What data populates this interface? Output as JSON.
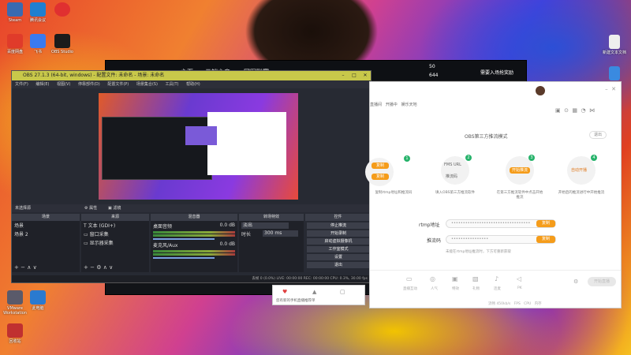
{
  "desktop": {
    "icons_left": [
      {
        "label": "Steam",
        "color": "#3a6ab0"
      },
      {
        "label": "腾讯会议",
        "color": "#1f7fd0"
      },
      {
        "label": "",
        "color": "#e03030"
      },
      {
        "label": "百度网盘",
        "color": "#e03b2a"
      },
      {
        "label": "飞书",
        "color": "#3a7af0"
      },
      {
        "label": "OBS Studio",
        "color": "#1b1b1b"
      }
    ],
    "icons_right": [
      {
        "label": "新建文本文档",
        "color": "#e8e8e8"
      },
      {
        "label": "",
        "color": "#3a8ae0"
      },
      {
        "label": "",
        "color": "#e8e8e8"
      }
    ],
    "icons_bottom_left": [
      {
        "label": "VMware Workstation",
        "color": "#5a5a6a"
      },
      {
        "label": "此电脑",
        "color": "#2a7ad0"
      },
      {
        "label": "回收站",
        "color": "#c03030"
      }
    ]
  },
  "game_window": {
    "nav": [
      "主页",
      "云端之音",
      "冠军联赛"
    ],
    "coins": "50",
    "gems": "644",
    "banner": "需要入场抢奖励"
  },
  "obs": {
    "title": "OBS 27.1.3 (64-bit, windows) - 配置文件: 未命名 - 场景: 未命名",
    "menu": [
      "文件(F)",
      "编辑(E)",
      "视图(V)",
      "停靠部件(D)",
      "配置文件(P)",
      "场景集合(S)",
      "工具(T)",
      "帮助(H)"
    ],
    "source_bar": {
      "selected": "未选择源",
      "props": "属性",
      "filters": "滤镜"
    },
    "docks": {
      "scenes": {
        "header": "场景",
        "items": [
          "场景",
          "场景 2"
        ]
      },
      "sources": {
        "header": "来源",
        "items": [
          "文本 (GDI+)",
          "窗口采集",
          "显示器采集"
        ]
      },
      "mixer": {
        "header": "混音器",
        "tracks": [
          {
            "name": "桌面音频",
            "db": "0.0 dB"
          },
          {
            "name": "麦克风/Aux",
            "db": "0.0 dB"
          }
        ]
      },
      "transitions": {
        "header": "转场特效",
        "effect": "淡出",
        "duration_label": "时长",
        "duration": "300 ms"
      },
      "controls": {
        "header": "控件",
        "buttons": [
          "停止推流",
          "开始录制",
          "启动虚拟摄像机",
          "工作室模式",
          "设置",
          "退出"
        ]
      }
    },
    "statusbar": "丢帧 0 (0.0%)   LIVE: 00:00:00   REC: 00:00:00   CPU: 0.3%, 30.00 fps"
  },
  "panel": {
    "tabs": [
      "直播间",
      "开播中",
      "娱乐天地"
    ],
    "mode_title": "OBS第三方推流模式",
    "exit_label": "退出",
    "steps": [
      {
        "num": "1",
        "text": "复制rtmp地址和推流码"
      },
      {
        "num": "2",
        "text": "填入OBS第三方推流软件"
      },
      {
        "num": "3",
        "text": "在第三方推流软件中点击开始推流"
      },
      {
        "num": "4",
        "text": "开始后的推流进行中开始推流"
      }
    ],
    "step_badges": [
      "FMS URL",
      "推流码",
      "开始推流",
      "自动开播"
    ],
    "step_copy": [
      "复制",
      "复制"
    ],
    "rtmp_label": "rtmp地址",
    "rtmp_value": "••••••••••••••••••••••••••••••••••",
    "key_label": "推流码",
    "key_value": "••••••••••••••••",
    "copy_btn": "复制",
    "note": "未能在rtmp地址推流时，下方可重新获取",
    "toolbar": [
      "直播互动",
      "人气",
      "特效",
      "礼物",
      "连麦",
      "PK"
    ],
    "start_btn": "开始直播",
    "footer": [
      "流畅",
      "450kb/s",
      "FPS",
      "CPU",
      "内存"
    ]
  },
  "popup": {
    "text": "您有新的手机直播推荐单"
  }
}
